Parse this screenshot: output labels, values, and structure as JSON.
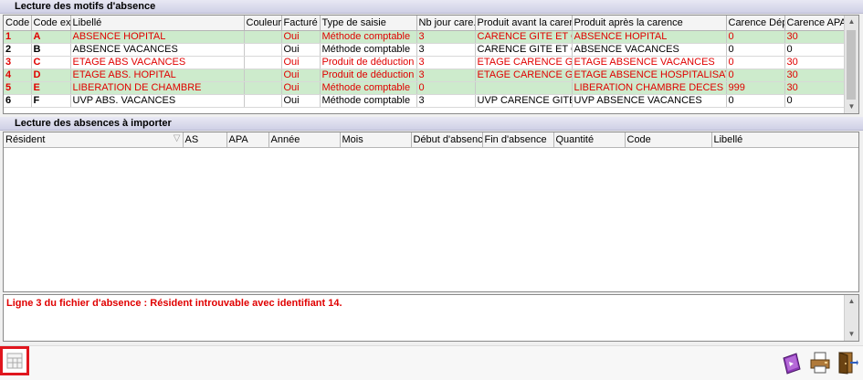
{
  "motifs": {
    "title": "Lecture des motifs d'absence",
    "columns": [
      "Code",
      "Code ext.",
      "Libellé",
      "Couleur",
      "Facturé",
      "Type de saisie",
      "Nb jour care...",
      "Produit avant la carence",
      "Produit après la carence",
      "Carence Dép.",
      "Carence APA"
    ],
    "rows": [
      {
        "code": "1",
        "ext": "A",
        "libelle": "ABSENCE HOPITAL",
        "couleur": "",
        "facture": "Oui",
        "type": "Méthode comptable",
        "nb": "3",
        "avant": "CARENCE GITE ET COUVERT",
        "apres": "ABSENCE HOPITAL",
        "dep": "0",
        "apa": "30",
        "red": true,
        "bg": "green"
      },
      {
        "code": "2",
        "ext": "B",
        "libelle": "ABSENCE VACANCES",
        "couleur": "",
        "facture": "Oui",
        "type": "Méthode comptable",
        "nb": "3",
        "avant": "CARENCE GITE ET COUVERT",
        "apres": "ABSENCE  VACANCES",
        "dep": "0",
        "apa": "0",
        "red": false,
        "bg": "white"
      },
      {
        "code": "3",
        "ext": "C",
        "libelle": "ETAGE ABS VACANCES",
        "couleur": "",
        "facture": "Oui",
        "type": "Produit de déduction",
        "nb": "3",
        "avant": "ETAGE  CARENCE GITE ET",
        "apres": "ETAGE  ABSENCE VACANCES",
        "dep": "0",
        "apa": "30",
        "red": true,
        "bg": "white"
      },
      {
        "code": "4",
        "ext": "D",
        "libelle": "ETAGE ABS. HOPITAL",
        "couleur": "",
        "facture": "Oui",
        "type": "Produit de déduction",
        "nb": "3",
        "avant": "ETAGE  CARENCE GITE ET",
        "apres": "ETAGE  ABSENCE  HOSPITALISATION",
        "dep": "0",
        "apa": "30",
        "red": true,
        "bg": "green"
      },
      {
        "code": "5",
        "ext": "E",
        "libelle": "LIBERATION DE CHAMBRE",
        "couleur": "",
        "facture": "Oui",
        "type": "Méthode comptable",
        "nb": "0",
        "avant": "",
        "apres": "LIBERATION CHAMBRE DECES",
        "dep": "999",
        "apa": "30",
        "red": true,
        "bg": "green"
      },
      {
        "code": "6",
        "ext": "F",
        "libelle": "UVP ABS. VACANCES",
        "couleur": "",
        "facture": "Oui",
        "type": "Méthode comptable",
        "nb": "3",
        "avant": "UVP  CARENCE GITE ET COUVERT",
        "apres": "UVP  ABSENCE VACANCES",
        "dep": "0",
        "apa": "0",
        "red": false,
        "bg": "white"
      }
    ]
  },
  "absences": {
    "title": "Lecture des absences à importer",
    "columns": [
      "Résident",
      "AS",
      "APA",
      "Année",
      "Mois",
      "Début d'absence",
      "Fin d'absence",
      "Quantité",
      "Code",
      "Libellé"
    ]
  },
  "message": "Ligne 3 du fichier d'absence : Résident introuvable avec identifiant 14.",
  "icons": [
    "table-icon",
    "import-book-icon",
    "print-icon",
    "exit-door-icon"
  ]
}
